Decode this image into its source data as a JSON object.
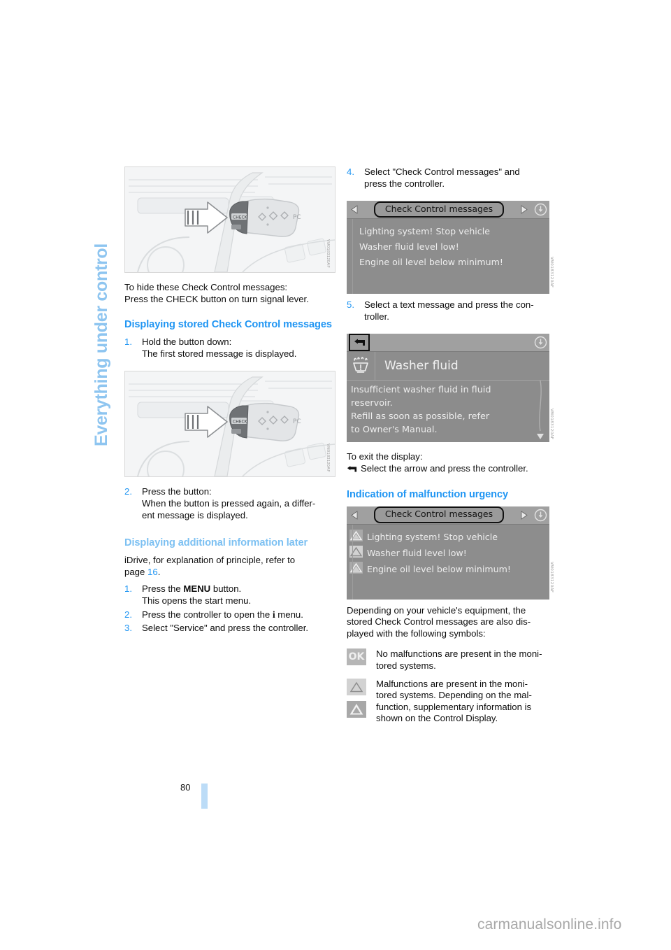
{
  "chapter": {
    "title": "Everything under control"
  },
  "folio": {
    "page_number": "80"
  },
  "watermark": {
    "text": "carmanualsonline.info"
  },
  "left_column": {
    "illustration_1": {
      "name": "turn-signal-lever-check-button",
      "figure_code": "VM0183120AF"
    },
    "para_hide": {
      "line1": "To hide these Check Control messages:",
      "line2": "Press the CHECK button on turn signal lever."
    },
    "heading_stored": "Displaying stored Check Control messages",
    "step_1": {
      "num": "1.",
      "line1": "Hold the button down:",
      "line2": "The first stored message is displayed."
    },
    "illustration_2": {
      "name": "turn-signal-lever-check-button",
      "figure_code": "VM0183120AF"
    },
    "step_2": {
      "num": "2.",
      "line1": "Press the button:",
      "line2": "When the button is pressed again, a differ-",
      "line3": "ent message is displayed."
    },
    "heading_additional": "Displaying additional information later",
    "para_idrive": {
      "line1": "iDrive, for explanation of principle, refer to",
      "line2_prefix": "page",
      "line2_ref": "16",
      "line2_suffix": "."
    },
    "step_m1": {
      "num": "1.",
      "line1_pre": "Press the ",
      "line1_kbd": "MENU",
      "line1_post": " button.",
      "line2": "This opens the start menu."
    },
    "step_m2": {
      "num": "2.",
      "line1_pre": "Press the controller to open the ",
      "line1_icon": "i",
      "line1_post": " menu."
    },
    "step_m3": {
      "num": "3.",
      "line1": "Select \"Service\" and press the controller."
    }
  },
  "right_column": {
    "step_4": {
      "num": "4.",
      "line1": "Select \"Check Control messages\" and",
      "line2": "press the controller."
    },
    "screen_messages": {
      "title": "Check Control messages",
      "left_arrow_icon": "triangle-left-icon",
      "right_arrow_icon": "triangle-right-icon",
      "info_icon": "warning-circle-icon",
      "messages": [
        "Lighting system! Stop vehicle",
        "Washer fluid level low!",
        "Engine oil level below minimum!"
      ],
      "figure_code": "VM0183120AF"
    },
    "step_5": {
      "num": "5.",
      "line1": "Select a text message and press the con-",
      "line2": "troller."
    },
    "screen_detail": {
      "back_icon": "back-arrow-icon",
      "info_icon": "warning-circle-icon",
      "item_icon": "washer-fluid-icon",
      "item_title": "Washer fluid",
      "body_lines": [
        "Insufficient washer fluid in fluid",
        "reservoir.",
        "Refill as soon as possible, refer",
        "to Owner's Manual."
      ],
      "scroll_down_icon": "chevron-down-icon",
      "figure_code": "VM0183120AF"
    },
    "exit": {
      "line1": "To exit the display:",
      "icon": "back-arrow-icon",
      "line2": "Select the arrow and press the controller."
    },
    "heading_urgency": "Indication of malfunction urgency",
    "screen_urgency": {
      "title": "Check Control messages",
      "left_arrow_icon": "triangle-left-icon",
      "right_arrow_icon": "triangle-right-icon",
      "info_icon": "warning-circle-icon",
      "rows": [
        {
          "icon": "warning-triangle-filled-icon",
          "text": "Lighting system! Stop vehicle"
        },
        {
          "icon": "warning-triangle-outline-icon",
          "text": "Washer fluid level low!"
        },
        {
          "icon": "warning-triangle-filled-icon",
          "text": "Engine oil level below minimum!"
        }
      ],
      "figure_code": "VM0183120AF"
    },
    "para_depending": {
      "line1": "Depending on your vehicle's equipment, the",
      "line2": "stored Check Control messages are also dis-",
      "line3": "played with the following symbols:"
    },
    "legend": [
      {
        "symbol_label": "OK",
        "symbol_icon": "ok-badge-icon",
        "text_line1": "No malfunctions are present in the moni-",
        "text_line2": "tored systems."
      },
      {
        "symbol_icon_1": "warning-triangle-light-icon",
        "symbol_icon_2": "warning-triangle-dark-icon",
        "text_line1": "Malfunctions are present in the moni-",
        "text_line2": "tored systems. Depending on the mal-",
        "text_line3": "function, supplementary information is",
        "text_line4": "shown on the Control Display."
      }
    ]
  },
  "colors": {
    "accent_blue": "#2196f3",
    "chapter_blue": "#8ec5f0",
    "folio_bar": "#bcdcf7",
    "display_gray": "#8c8c8c",
    "display_bar_gray": "#a0a0a0"
  }
}
